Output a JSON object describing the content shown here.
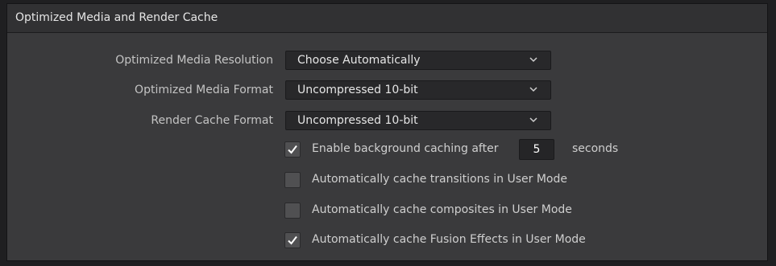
{
  "panel": {
    "title": "Optimized Media and Render Cache"
  },
  "settings": {
    "optimized_media_resolution": {
      "label": "Optimized Media Resolution",
      "value": "Choose Automatically"
    },
    "optimized_media_format": {
      "label": "Optimized Media Format",
      "value": "Uncompressed 10-bit"
    },
    "render_cache_format": {
      "label": "Render Cache Format",
      "value": "Uncompressed 10-bit"
    }
  },
  "checkboxes": {
    "background_caching": {
      "label": "Enable background caching after",
      "checked": true,
      "seconds_value": "5",
      "seconds_label": "seconds"
    },
    "cache_transitions": {
      "label": "Automatically cache transitions in User Mode",
      "checked": false
    },
    "cache_composites": {
      "label": "Automatically cache composites in User Mode",
      "checked": false
    },
    "cache_fusion": {
      "label": "Automatically cache Fusion Effects in User Mode",
      "checked": true
    }
  },
  "icons": {
    "dropdown": "chevron-down-icon",
    "check": "checkmark-icon"
  },
  "colors": {
    "panel_bg": "#3a3a3c",
    "header_bg": "#313133",
    "field_bg": "#28282a",
    "checkbox_bg": "#505052"
  }
}
